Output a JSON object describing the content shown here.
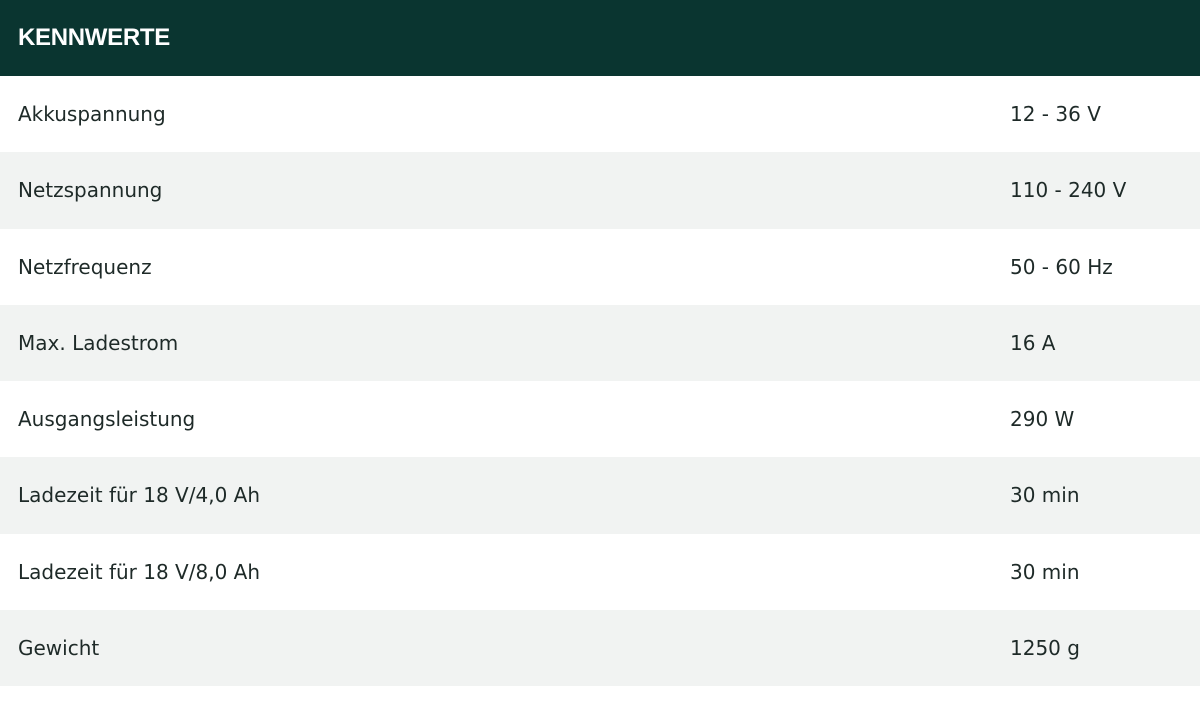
{
  "header": {
    "title": "KENNWERTE"
  },
  "rows": [
    {
      "label": "Akkuspannung",
      "value": "12 - 36 V"
    },
    {
      "label": "Netzspannung",
      "value": "110 - 240 V"
    },
    {
      "label": "Netzfrequenz",
      "value": "50 - 60 Hz"
    },
    {
      "label": "Max. Ladestrom",
      "value": "16 A"
    },
    {
      "label": "Ausgangsleistung",
      "value": "290 W"
    },
    {
      "label": "Ladezeit für 18 V/4,0 Ah",
      "value": "30 min"
    },
    {
      "label": "Ladezeit für 18 V/8,0 Ah",
      "value": "30 min"
    },
    {
      "label": "Gewicht",
      "value": "1250 g"
    }
  ],
  "colors": {
    "header_bg": "#0a3530",
    "row_alt_bg": "#f1f3f2",
    "text": "#1e2a28"
  }
}
